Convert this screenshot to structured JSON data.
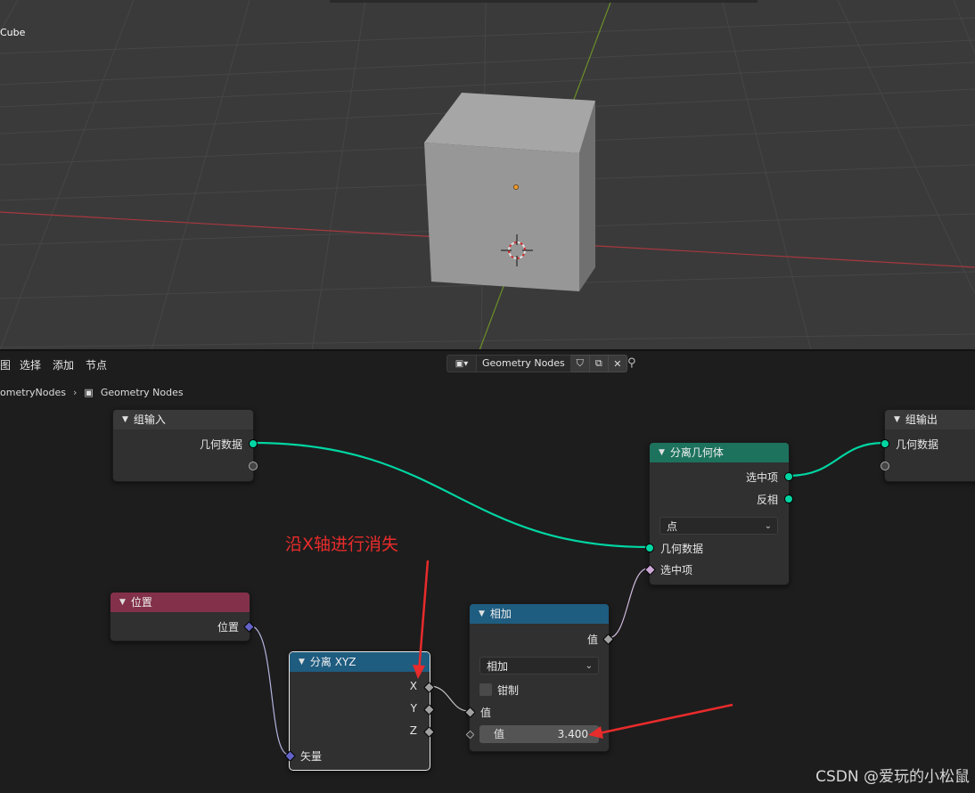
{
  "viewport": {
    "object_label": "Cube",
    "colors": {
      "background": "#3a3a3a",
      "grid": "#444444",
      "x_axis": "#a8383f",
      "y_axis": "#6b8f28"
    }
  },
  "node_editor": {
    "menu": [
      "图",
      "选择",
      "添加",
      "节点"
    ],
    "tree_type_icon": "node-tree-icon",
    "tree_name": "Geometry Nodes",
    "tree_buttons": [
      "shield-icon",
      "copy-icon",
      "close-icon"
    ],
    "pin_icon": "pin-icon",
    "breadcrumb": [
      "ometryNodes",
      "Geometry Nodes"
    ]
  },
  "nodes": {
    "group_input": {
      "title": "组输入",
      "outputs": [
        "几何数据"
      ]
    },
    "group_output": {
      "title": "组输出",
      "inputs": [
        "几何数据"
      ]
    },
    "separate_geometry": {
      "title": "分离几何体",
      "outputs": [
        "选中项",
        "反相"
      ],
      "domain": "点",
      "inputs": [
        "几何数据",
        "选中项"
      ]
    },
    "position": {
      "title": "位置",
      "outputs": [
        "位置"
      ]
    },
    "separate_xyz": {
      "title": "分离 XYZ",
      "outputs": [
        "X",
        "Y",
        "Z"
      ],
      "inputs": [
        "矢量"
      ]
    },
    "math_add": {
      "title": "相加",
      "output": "值",
      "operation": "相加",
      "clamp_label": "钳制",
      "input1_label": "值",
      "input2_label": "值",
      "input2_value": "3.400"
    }
  },
  "annotation": {
    "text": "沿X轴进行消失",
    "color": "#e82b2b"
  },
  "watermark": "CSDN @爱玩的小松鼠",
  "colors": {
    "geometry_socket": "#00d6a3",
    "vector_socket": "#6363c7",
    "float_socket": "#a1a1a1",
    "bool_socket": "#cca6d6"
  }
}
